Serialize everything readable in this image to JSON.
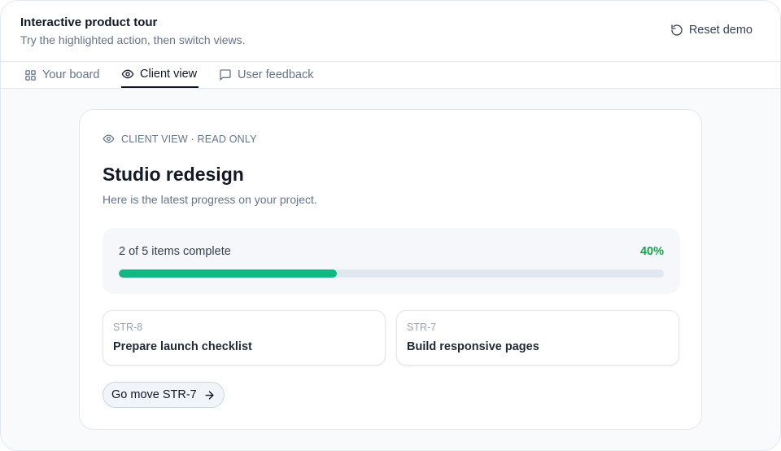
{
  "header": {
    "title": "Interactive product tour",
    "subtitle": "Try the highlighted action, then switch views.",
    "reset_label": "Reset demo",
    "reset_icon": "rotate-ccw-icon"
  },
  "tabs": [
    {
      "label": "Your board",
      "icon": "grid-icon",
      "active": false
    },
    {
      "label": "Client view",
      "icon": "eye-icon",
      "active": true
    },
    {
      "label": "User feedback",
      "icon": "message-square-icon",
      "active": false
    }
  ],
  "client_card": {
    "eyebrow": "CLIENT VIEW · READ ONLY",
    "eyebrow_icon": "eye-icon",
    "title": "Studio redesign",
    "description": "Here is the latest progress on your project.",
    "progress": {
      "label": "2 of 5 items complete",
      "percent_label": "40%",
      "completed": 2,
      "total": 5,
      "fraction": 0.4
    },
    "issues": [
      {
        "key": "STR-8",
        "title": "Prepare launch checklist"
      },
      {
        "key": "STR-7",
        "title": "Build responsive pages"
      }
    ],
    "cta_label": "Go move STR-7",
    "cta_icon": "arrow-right-icon"
  },
  "colors": {
    "accent_green": "#10b981",
    "percent_green": "#16a34a",
    "text_primary": "#111827",
    "text_muted": "#64748b"
  }
}
